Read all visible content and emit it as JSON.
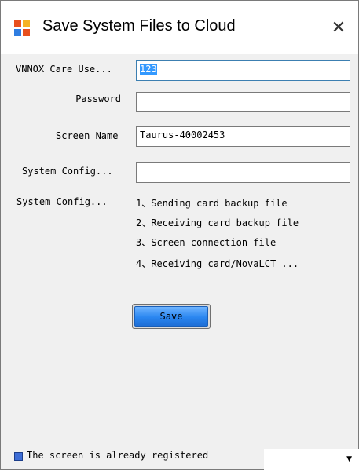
{
  "window": {
    "title": "Save System Files to Cloud",
    "close_glyph": "✕"
  },
  "form": {
    "account_label": "VNNOX Care Use...",
    "account_value": "123",
    "password_label": "Password",
    "password_value": "",
    "screen_name_label": "Screen Name",
    "screen_name_value": "Taurus-40002453",
    "config_name_label": "System Config...",
    "config_name_value": "",
    "config_files_label": "System Config...",
    "config_files": [
      "1、Sending card backup file",
      "2、Receiving card backup file",
      "3、Screen connection file",
      "4、Receiving card/NovaLCT ..."
    ],
    "save_label": "Save"
  },
  "status": {
    "text": "The screen is already registered",
    "icon": "blue-square-icon"
  },
  "combo": {
    "value": "",
    "icon": "chevron-down-icon"
  }
}
